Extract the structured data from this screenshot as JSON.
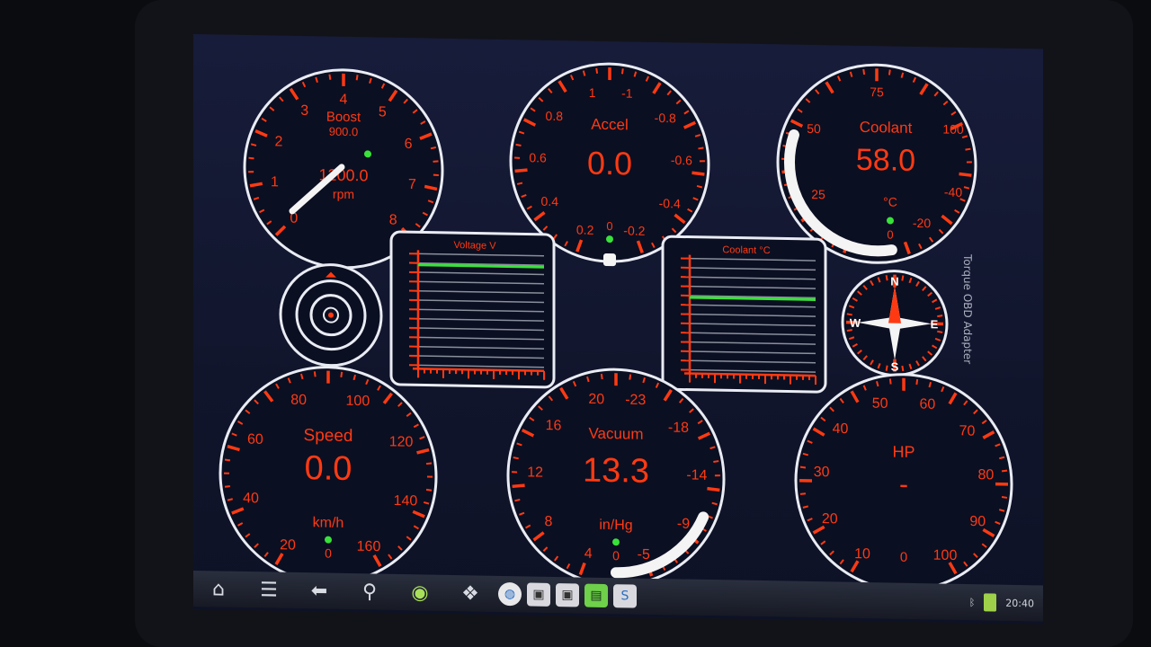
{
  "gauges": {
    "boost": {
      "label": "Boost",
      "sub": "900.0",
      "value": "1200.0",
      "unit": "rpm",
      "ticks": [
        "0",
        "1",
        "2",
        "3",
        "4",
        "5",
        "6",
        "7",
        "8"
      ],
      "needle_fraction": 0.2
    },
    "accel": {
      "label": "Accel",
      "value": "0.0",
      "ticks": [
        "0.2",
        "0.4",
        "0.6",
        "0.8",
        "1",
        "-1",
        "-0.8",
        "-0.6",
        "-0.4",
        "-0.2"
      ],
      "zero": "0"
    },
    "coolant": {
      "label": "Coolant",
      "value": "58.0",
      "unit": "°C",
      "ticks": [
        "-20",
        "-40",
        "25",
        "50",
        "75",
        "100"
      ],
      "zero": "0",
      "fill_fraction": 0.37
    },
    "speed": {
      "label": "Speed",
      "value": "0.0",
      "unit": "km/h",
      "ticks": [
        "20",
        "40",
        "60",
        "80",
        "100",
        "120",
        "140",
        "160"
      ],
      "zero": "0"
    },
    "vacuum": {
      "label": "Vacuum",
      "value": "13.3",
      "unit": "in/Hg",
      "ticks": [
        "4",
        "8",
        "12",
        "16",
        "20",
        "-23",
        "-18",
        "-14",
        "-9",
        "-5"
      ],
      "zero": "0",
      "fill_fraction": 0.27
    },
    "hp": {
      "label": "HP",
      "value": "-",
      "ticks": [
        "10",
        "20",
        "30",
        "40",
        "50",
        "60",
        "70",
        "80",
        "90",
        "100"
      ],
      "zero": "0"
    }
  },
  "graphs": {
    "voltage": {
      "title": "Voltage V",
      "level": 0.9
    },
    "coolant": {
      "title": "Coolant °C",
      "level": 0.65
    }
  },
  "compass": {
    "n": "N",
    "s": "S",
    "e": "E",
    "w": "W"
  },
  "sidebar_label": "Torque OBD Adapter",
  "status": {
    "time": "20:40"
  },
  "colors": {
    "accent": "#ff3a12",
    "ring": "#e9ecf3",
    "green": "#38e23a"
  },
  "taskbar": {
    "icons": [
      "home-icon",
      "menu-icon",
      "back-icon",
      "search-icon",
      "bug-icon",
      "layers-icon"
    ]
  }
}
